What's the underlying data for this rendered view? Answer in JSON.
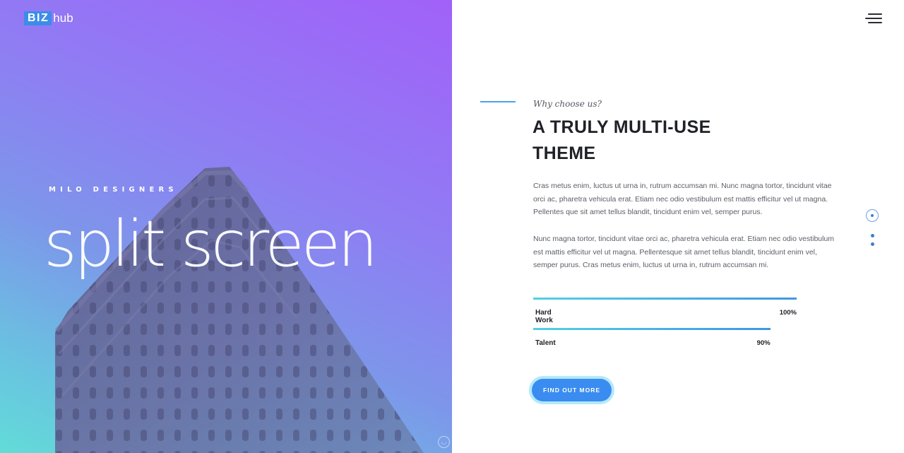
{
  "brand": {
    "box": "BIZ",
    "text": "hub"
  },
  "hero": {
    "eyebrow": "MILO DESIGNERS",
    "title": "split screen"
  },
  "section": {
    "kicker": "Why choose us?",
    "heading_line1": "A TRULY MULTI-USE",
    "heading_line2": "THEME",
    "paragraph1": "Cras metus enim, luctus ut urna in, rutrum accumsan mi. Nunc magna tortor, tincidunt vitae orci ac, pharetra vehicula erat. Etiam nec odio vestibulum est mattis efficitur vel ut magna. Pellentes que sit amet tellus blandit, tincidunt enim vel, semper purus.",
    "paragraph2": "Nunc magna tortor, tincidunt vitae orci ac, pharetra vehicula erat. Etiam nec odio vestibulum est mattis efficitur vel ut magna. Pellentesque sit amet tellus blandit, tincidunt enim vel, semper purus. Cras metus enim, luctus ut urna in, rutrum accumsan mi."
  },
  "skills": [
    {
      "label": "Hard Work",
      "percent_text": "100%",
      "value": 100
    },
    {
      "label": "Talent",
      "percent_text": "90%",
      "value": 90
    }
  ],
  "cta": {
    "label": "FIND OUT MORE"
  },
  "icons": {
    "menu": "hamburger-menu-icon",
    "watermark": "watermark-badge-icon"
  },
  "colors": {
    "gradient_top": "#a161f9",
    "gradient_bottom": "#62dcd8",
    "accent_blue": "#3a8cf0",
    "skill_bar_start": "#52d0e5",
    "skill_bar_end": "#3f97e3",
    "heading": "#1f2127"
  }
}
